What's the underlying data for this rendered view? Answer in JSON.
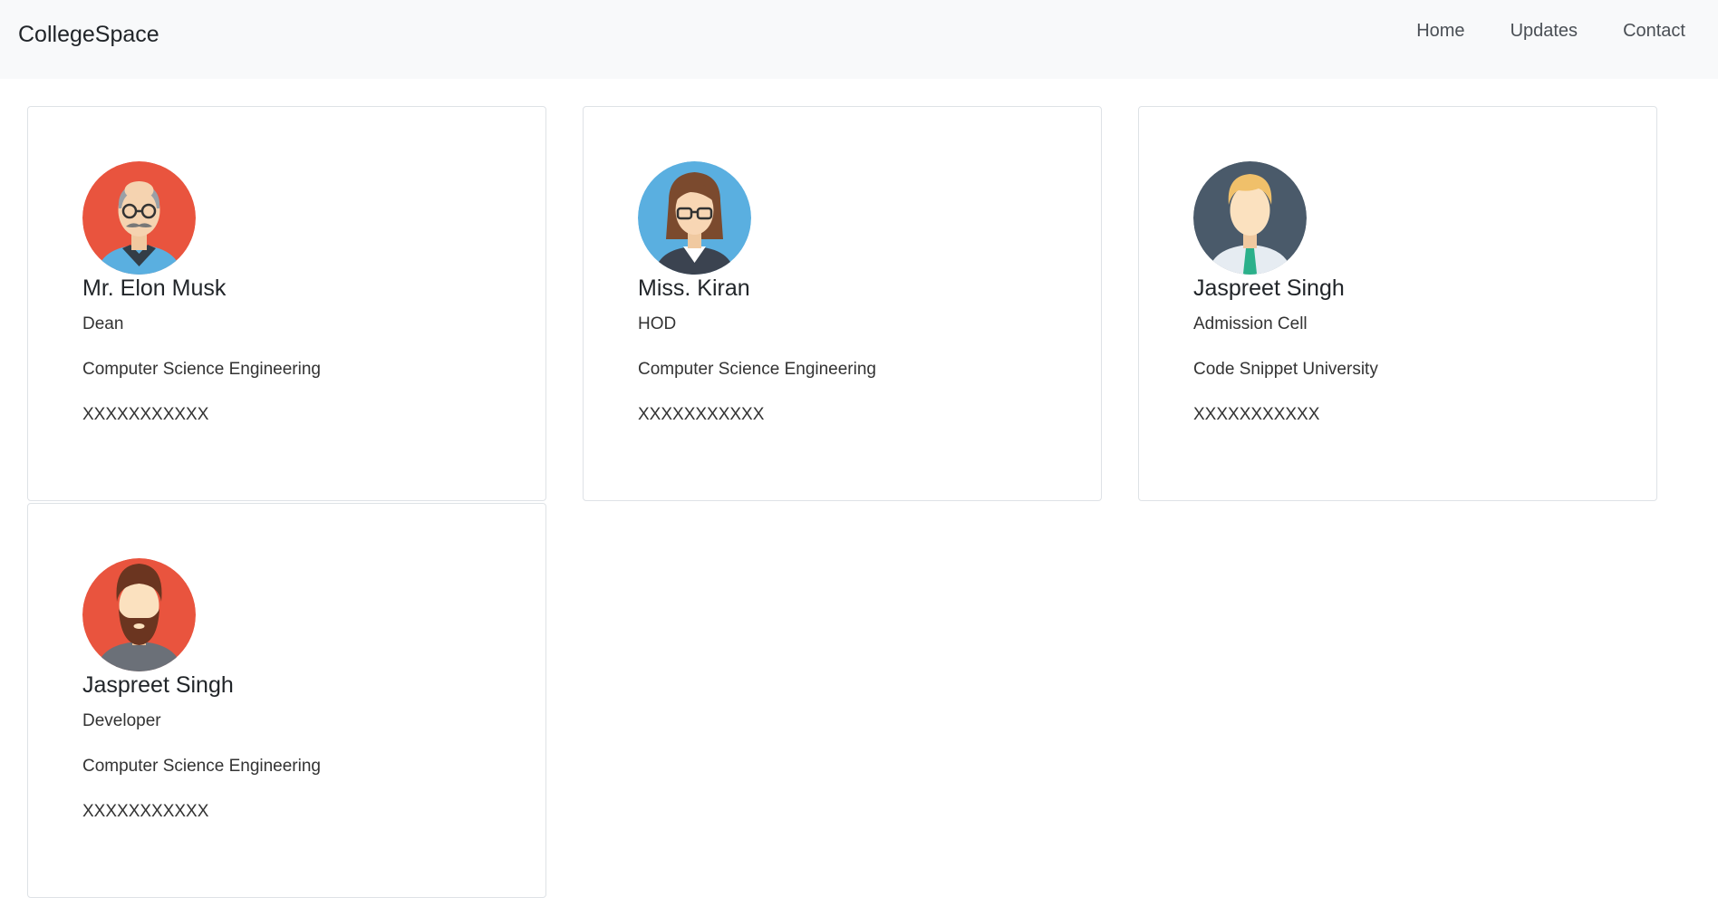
{
  "navbar": {
    "brand": "CollegeSpace",
    "links": [
      {
        "label": "Home"
      },
      {
        "label": "Updates"
      },
      {
        "label": "Contact"
      }
    ]
  },
  "profiles": [
    {
      "name": "Mr. Elon Musk",
      "role": "Dean",
      "department": "Computer Science Engineering",
      "phone": "XXXXXXXXXXX",
      "avatar": "elderly-man-glasses-avatar"
    },
    {
      "name": "Miss. Kiran",
      "role": "HOD",
      "department": "Computer Science Engineering",
      "phone": "XXXXXXXXXXX",
      "avatar": "woman-glasses-avatar"
    },
    {
      "name": "Jaspreet Singh",
      "role": "Admission Cell",
      "department": "Code Snippet University",
      "phone": "XXXXXXXXXXX",
      "avatar": "blond-man-tie-avatar"
    },
    {
      "name": "Jaspreet Singh",
      "role": "Developer",
      "department": "Computer Science Engineering",
      "phone": "XXXXXXXXXXX",
      "avatar": "bearded-man-avatar"
    }
  ],
  "colors": {
    "navbar_bg": "#f8f9fa",
    "card_border": "#dee2e6",
    "avatar_red": "#e9543e",
    "avatar_blue": "#5aafe0",
    "avatar_slate": "#4a5a6a"
  }
}
